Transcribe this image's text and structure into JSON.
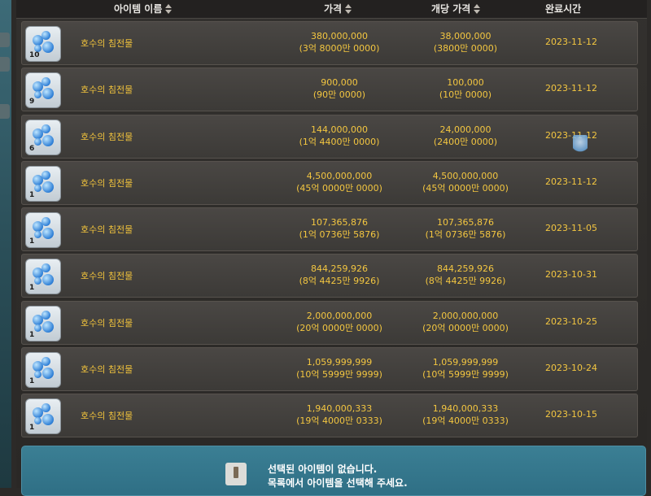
{
  "header": {
    "name_col": "아이템 이름",
    "price_col": "가격",
    "unit_col": "개당 가격",
    "date_col": "완료시간"
  },
  "rows": [
    {
      "name": "호수의 침전물",
      "qty": "10",
      "price": "380,000,000",
      "price_kr": "(3억 8000만 0000)",
      "unit": "38,000,000",
      "unit_kr": "(3800만 0000)",
      "date": "2023-11-12"
    },
    {
      "name": "호수의 침전물",
      "qty": "9",
      "price": "900,000",
      "price_kr": "(90만 0000)",
      "unit": "100,000",
      "unit_kr": "(10만 0000)",
      "date": "2023-11-12"
    },
    {
      "name": "호수의 침전물",
      "qty": "6",
      "price": "144,000,000",
      "price_kr": "(1억 4400만 0000)",
      "unit": "24,000,000",
      "unit_kr": "(2400만 0000)",
      "date": "2023-11-12"
    },
    {
      "name": "호수의 침전물",
      "qty": "1",
      "price": "4,500,000,000",
      "price_kr": "(45억 0000만 0000)",
      "unit": "4,500,000,000",
      "unit_kr": "(45억 0000만 0000)",
      "date": "2023-11-12"
    },
    {
      "name": "호수의 침전물",
      "qty": "1",
      "price": "107,365,876",
      "price_kr": "(1억 0736만 5876)",
      "unit": "107,365,876",
      "unit_kr": "(1억 0736만 5876)",
      "date": "2023-11-05"
    },
    {
      "name": "호수의 침전물",
      "qty": "1",
      "price": "844,259,926",
      "price_kr": "(8억 4425만 9926)",
      "unit": "844,259,926",
      "unit_kr": "(8억 4425만 9926)",
      "date": "2023-10-31"
    },
    {
      "name": "호수의 침전물",
      "qty": "1",
      "price": "2,000,000,000",
      "price_kr": "(20억 0000만 0000)",
      "unit": "2,000,000,000",
      "unit_kr": "(20억 0000만 0000)",
      "date": "2023-10-25"
    },
    {
      "name": "호수의 침전물",
      "qty": "1",
      "price": "1,059,999,999",
      "price_kr": "(10억 5999만 9999)",
      "unit": "1,059,999,999",
      "unit_kr": "(10억 5999만 9999)",
      "date": "2023-10-24"
    },
    {
      "name": "호수의 침전물",
      "qty": "1",
      "price": "1,940,000,333",
      "price_kr": "(19억 4000만 0333)",
      "unit": "1,940,000,333",
      "unit_kr": "(19억 4000만 0333)",
      "date": "2023-10-15"
    }
  ],
  "footer": {
    "line1": "선택된 아이템이 없습니다.",
    "line2": "목록에서 아이템을 선택해 주세요."
  },
  "colors": {
    "accent_gold": "#f3c640",
    "footer_blue": "#3b7f94"
  },
  "icons": {
    "item": "water-bubbles-icon",
    "footer": "box-info-icon"
  }
}
